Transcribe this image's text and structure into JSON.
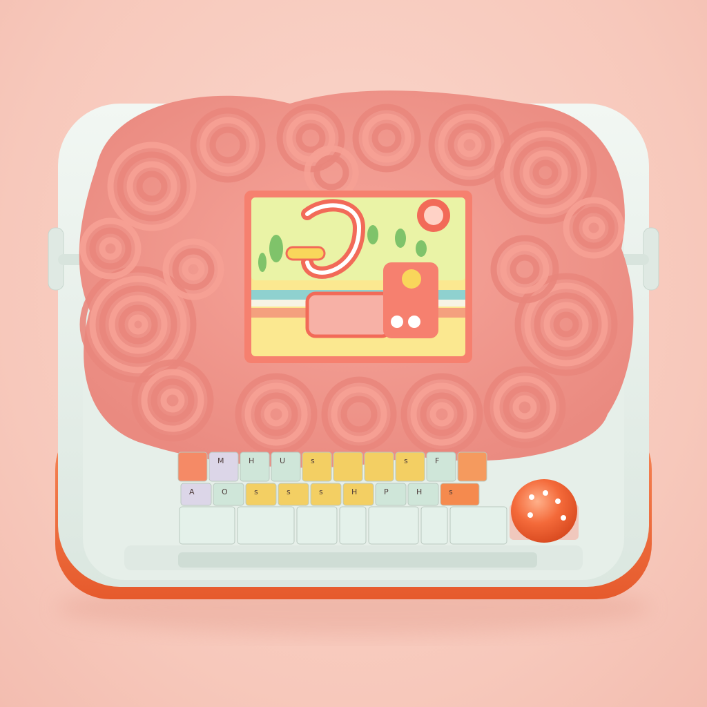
{
  "colors": {
    "background": "#f7c8bb",
    "device_body": "#e8f0ea",
    "device_base": "#f26b3a",
    "noodle": "#f49a8f",
    "noodle_shadow": "#d9746c",
    "screen_card": "#fbe27a",
    "screen_border": "#f0736a",
    "ball_button": "#f26a3a"
  },
  "keyboard": {
    "row1": [
      {
        "key": "top-0",
        "color": "#f58a66",
        "label": ""
      },
      {
        "key": "top-1",
        "color": "#dcd6e8",
        "label": "M"
      },
      {
        "key": "top-2",
        "color": "#cfe6d9",
        "label": "H"
      },
      {
        "key": "top-3",
        "color": "#cfe6d9",
        "label": "U"
      },
      {
        "key": "top-4",
        "color": "#f3cf63",
        "label": "s"
      },
      {
        "key": "top-5",
        "color": "#f3cf63",
        "label": ""
      },
      {
        "key": "top-6",
        "color": "#f3cf63",
        "label": ""
      },
      {
        "key": "top-7",
        "color": "#f3cf63",
        "label": "s"
      },
      {
        "key": "top-8",
        "color": "#cfe6d9",
        "label": "F"
      },
      {
        "key": "top-9",
        "color": "#f59a5e",
        "label": ""
      }
    ],
    "row2": [
      {
        "key": "mid-0",
        "color": "#dcd6e8",
        "label": "A"
      },
      {
        "key": "mid-1",
        "color": "#cfe6d9",
        "label": "O"
      },
      {
        "key": "mid-2",
        "color": "#f3cf63",
        "label": "s"
      },
      {
        "key": "mid-3",
        "color": "#f3cf63",
        "label": "s"
      },
      {
        "key": "mid-4",
        "color": "#f3cf63",
        "label": "s"
      },
      {
        "key": "mid-5",
        "color": "#f3cf63",
        "label": "H"
      },
      {
        "key": "mid-6",
        "color": "#cfe6d9",
        "label": "P"
      },
      {
        "key": "mid-7",
        "color": "#cfe6d9",
        "label": "H"
      },
      {
        "key": "mid-8",
        "color": "#f58a4e",
        "label": "s"
      }
    ],
    "row3": [
      {
        "key": "bot-0",
        "color": "#e4f1ea"
      },
      {
        "key": "bot-1",
        "color": "#e4f1ea"
      },
      {
        "key": "bot-2",
        "color": "#e4f1ea"
      },
      {
        "key": "bot-3",
        "color": "#e4f1ea"
      },
      {
        "key": "bot-4",
        "color": "#e4f1ea"
      },
      {
        "key": "bot-5",
        "color": "#e4f1ea"
      },
      {
        "key": "bot-6",
        "color": "#e4f1ea"
      }
    ]
  }
}
